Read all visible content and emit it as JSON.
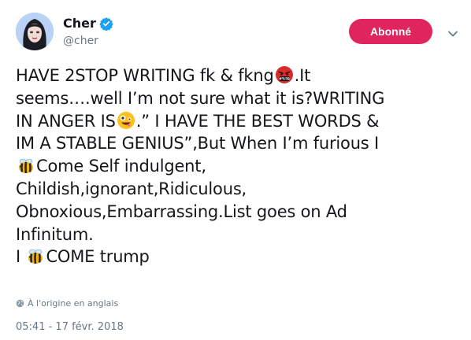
{
  "user": {
    "display_name": "Cher",
    "handle": "@cher",
    "verified_icon": "verified-badge-icon",
    "avatar_icon": "profile-avatar"
  },
  "follow_button": {
    "label": "Abonné"
  },
  "menu_icon": "chevron-down-icon",
  "tweet": {
    "line1_a": "HAVE 2STOP WRITING fk & fkng",
    "line1_b": ".It",
    "line2": "seems….well I’m not sure what it is?WRITING",
    "line3_a": "IN ANGER IS",
    "line3_b": ".” I HAVE THE BEST WORDS &",
    "line4": "IM A STABLE GENIUS”,But When I’m furious I",
    "line5_b": "Come Self indulgent,",
    "line6": "Childish,ignorant,Ridiculous,",
    "line7": "Obnoxious,Embarrassing.List goes on Ad",
    "line8": "Infinitum.",
    "line9_a": "I ",
    "line9_b": "COME trump",
    "emojis": {
      "swearing": "face-with-symbols-on-mouth-emoji",
      "zany": "zany-face-emoji",
      "bee": "honeybee-emoji"
    }
  },
  "translation": {
    "label": "À l'origine en anglais",
    "icon": "globe-icon"
  },
  "timestamp": "05:41 - 17 févr. 2018",
  "colors": {
    "follow_button": "#e0245e",
    "verified": "#1da1f2",
    "secondary_text": "#657786"
  }
}
